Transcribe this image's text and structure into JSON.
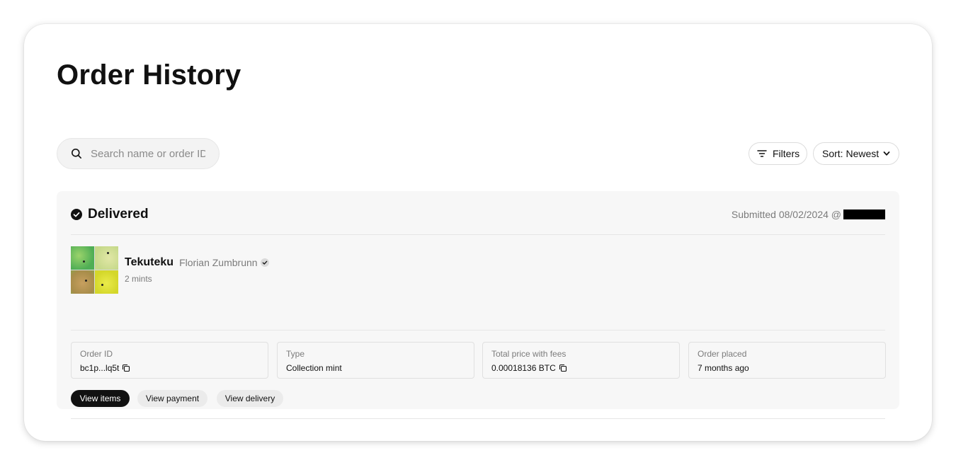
{
  "page": {
    "title": "Order History"
  },
  "search": {
    "placeholder": "Search name or order ID",
    "icon": "search-icon"
  },
  "toolbar": {
    "filters_label": "Filters",
    "sort_label": "Sort: Newest"
  },
  "order": {
    "status": "Delivered",
    "submitted": "Submitted 08/02/2024 @",
    "collection_name": "Tekuteku",
    "artist": "Florian Zumbrunn",
    "mints": "2 mints",
    "fields": [
      {
        "label": "Order ID",
        "value": "bc1p...lq5t"
      },
      {
        "label": "Type",
        "value": "Collection mint"
      },
      {
        "label": "Total price with fees",
        "value": "0.00018136 BTC"
      },
      {
        "label": "Order placed",
        "value": "7 months ago"
      }
    ],
    "tabs": [
      {
        "label": "View items",
        "active": true
      },
      {
        "label": "View payment",
        "active": false
      },
      {
        "label": "View delivery",
        "active": false
      }
    ]
  },
  "colors": {
    "accent": "#111111",
    "panel_bg": "#f7f7f7",
    "muted_text": "#7b7b7b"
  }
}
